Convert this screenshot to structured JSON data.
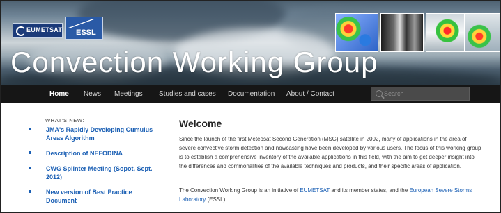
{
  "header": {
    "logo_eumetsat": "EUMETSAT",
    "logo_essl": "ESSL",
    "site_title": "Convection Working Group"
  },
  "nav": {
    "items": [
      "Home",
      "News",
      "Meetings",
      "Studies and cases",
      "Documentation",
      "About / Contact"
    ],
    "active": "Home",
    "search_placeholder": "Search"
  },
  "sidebar": {
    "heading": "WHAT'S NEW:",
    "news": [
      "JMA's Rapidly Developing Cumulus Areas Algorithm",
      "Description of NEFODINA",
      "CWG Splinter Meeting (Sopot, Sept. 2012)",
      "New version of Best Practice Document"
    ]
  },
  "main": {
    "title": "Welcome",
    "p1": "Since the launch of the first Meteosat Second Generation (MSG) satellite in 2002, many of applications in the area of severe convective storm detection and nowcasting have been developed by various users. The focus of this working group is to establish a comprehensive inventory of the available applications in this field, with the aim to get deeper insight into the differences and commonalities of the available techniques and products, and their specific areas of application.",
    "p2_before": "The Convection Working Group is an initiative of ",
    "p2_link1": "EUMETSAT",
    "p2_middle": " and its member states, and the ",
    "p2_link2": "European Severe Storms Laboratory",
    "p2_after": " (ESSL)."
  },
  "colors": {
    "link": "#1a5fb4",
    "nav_bg": "#161616"
  }
}
